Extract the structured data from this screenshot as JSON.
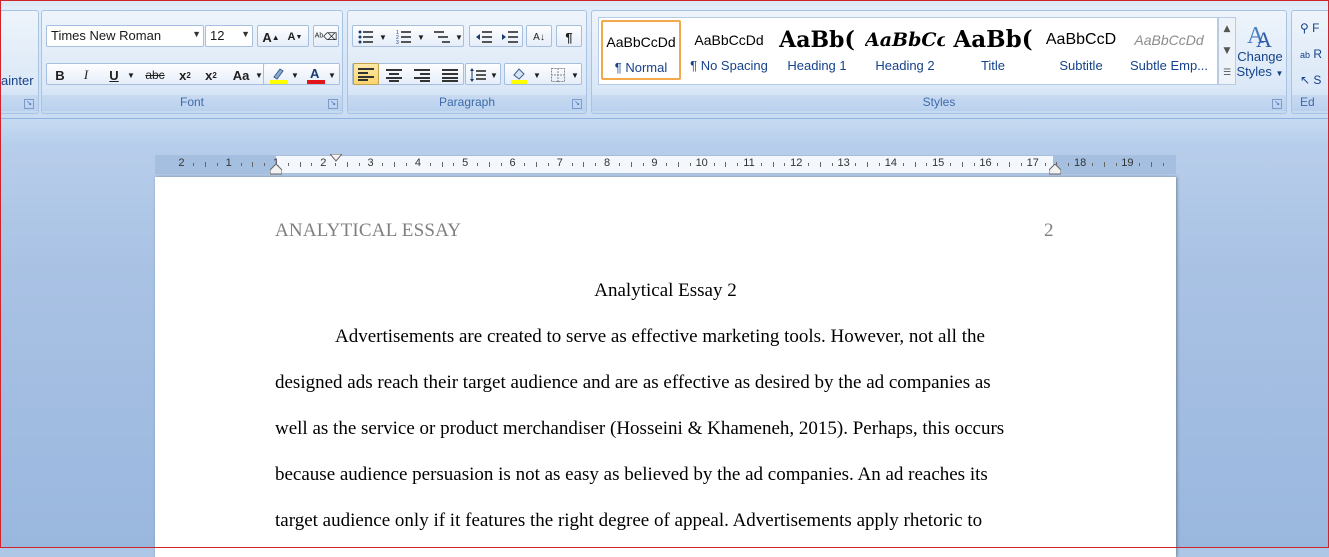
{
  "clipboard": {
    "format_painter_label": "ainter"
  },
  "font_group": {
    "label": "Font",
    "font_name": "Times New Roman",
    "font_size": "12"
  },
  "paragraph_group": {
    "label": "Paragraph"
  },
  "styles_group": {
    "label": "Styles",
    "tiles": [
      {
        "sample": "AaBbCcDd",
        "name": "¶ Normal"
      },
      {
        "sample": "AaBbCcDd",
        "name": "¶ No Spacing"
      },
      {
        "sample": "AaBb(",
        "name": "Heading 1"
      },
      {
        "sample": "AaBbCc",
        "name": "Heading 2"
      },
      {
        "sample": "AaBb(",
        "name": "Title"
      },
      {
        "sample": "AaBbCcD",
        "name": "Subtitle"
      },
      {
        "sample": "AaBbCcDd",
        "name": "Subtle Emp..."
      }
    ],
    "change_styles_line1": "Change",
    "change_styles_line2": "Styles"
  },
  "editing_group": {
    "label": "Ed",
    "items": [
      "F",
      "R",
      "S"
    ]
  },
  "ruler": {
    "labels": [
      "2",
      "1",
      "1",
      "2",
      "3",
      "4",
      "5",
      "6",
      "7",
      "8",
      "9",
      "10",
      "11",
      "12",
      "13",
      "14",
      "15",
      "16",
      "17",
      "18",
      "19"
    ]
  },
  "document": {
    "header_title": "ANALYTICAL ESSAY",
    "header_page": "2",
    "title": "Analytical Essay 2",
    "lines": [
      "Advertisements are created to serve as effective marketing tools. However, not all the",
      "designed ads reach their target audience and are as effective as desired by the ad companies as",
      "well as the service or product merchandiser (Hosseini & Khameneh, 2015). Perhaps, this occurs",
      "because audience persuasion is not as easy as believed by the ad companies. An ad reaches its",
      "target audience only if it features the right degree of appeal. Advertisements apply rhetoric to"
    ]
  },
  "colors": {
    "highlight": "#ffff00",
    "font_color": "#e0161b",
    "selected_style_border": "#f3a94b"
  }
}
